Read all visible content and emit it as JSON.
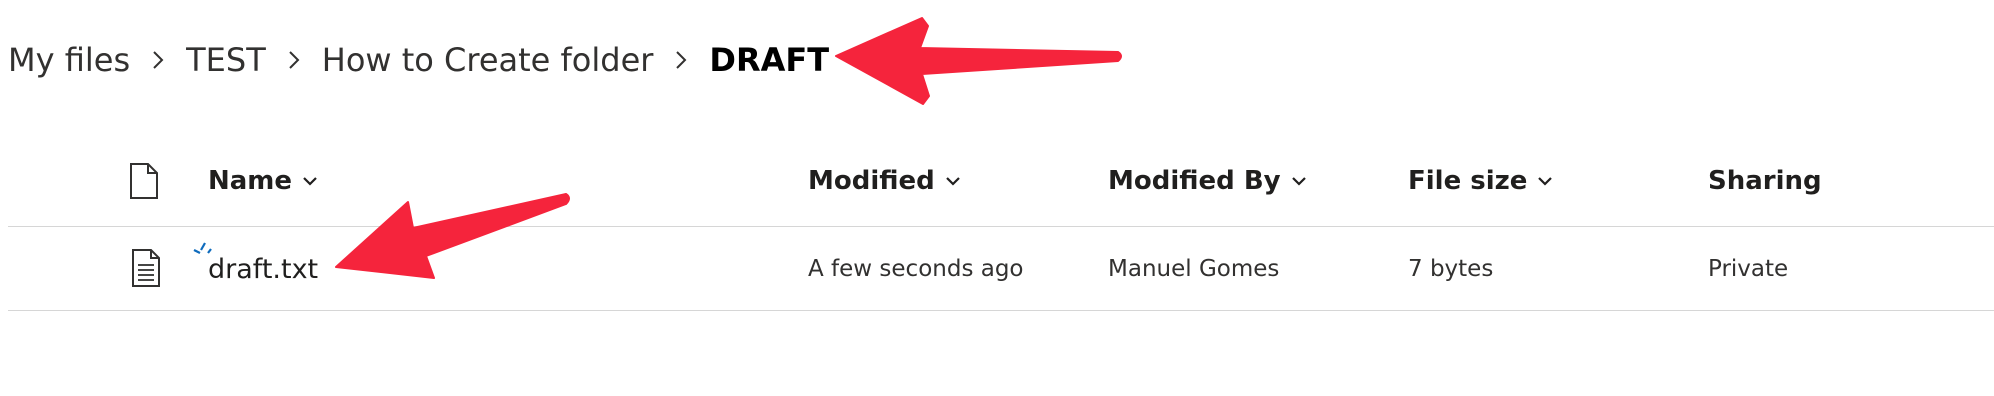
{
  "breadcrumb": {
    "items": [
      "My files",
      "TEST",
      "How to Create folder"
    ],
    "current": "DRAFT"
  },
  "columns": {
    "type_icon": "file-outline-icon",
    "name": "Name",
    "modified": "Modified",
    "modified_by": "Modified By",
    "file_size": "File size",
    "sharing": "Sharing"
  },
  "files": [
    {
      "icon": "text-document-icon",
      "name": "draft.txt",
      "modified": "A few seconds ago",
      "modified_by": "Manuel Gomes",
      "file_size": "7 bytes",
      "sharing": "Private"
    }
  ],
  "colors": {
    "annotation_arrow": "#f5243c",
    "new_item_marker": "#0f6cbd",
    "divider": "#d6d6d6"
  }
}
